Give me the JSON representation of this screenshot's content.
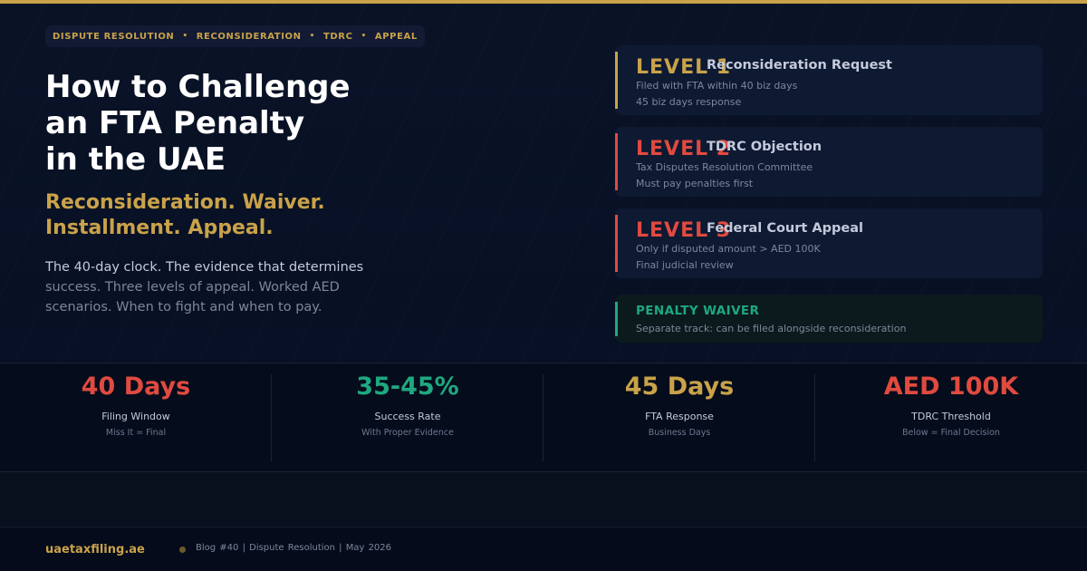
{
  "colors": {
    "gold": "#c9a24a",
    "red": "#e04a3f",
    "green": "#1ea87f"
  },
  "tags": [
    "DISPUTE RESOLUTION",
    "RECONSIDERATION",
    "TDRC",
    "APPEAL"
  ],
  "tag_separator": "•",
  "title": [
    "How to Challenge",
    "an FTA Penalty",
    "in the UAE"
  ],
  "subtitle": [
    "Reconsideration. Waiver.",
    "Installment. Appeal."
  ],
  "description": {
    "lead": "The 40-day clock. The evidence that determines",
    "rest": "success. Three levels of appeal. Worked AED scenarios. When to fight and when to pay."
  },
  "levels": [
    {
      "label": "LEVEL 1",
      "name": "Reconsideration Request",
      "detail": "Filed with FTA within 40 biz days",
      "note": "45 biz days response",
      "color": "#c9a24a"
    },
    {
      "label": "LEVEL 2",
      "name": "TDRC Objection",
      "detail": "Tax Disputes Resolution Committee",
      "note": "Must pay penalties first",
      "color": "#e04a3f"
    },
    {
      "label": "LEVEL 3",
      "name": "Federal Court Appeal",
      "detail": "Only if disputed amount > AED 100K",
      "note": "Final judicial review",
      "color": "#e04a3f"
    }
  ],
  "waiver": {
    "title": "PENALTY WAIVER",
    "detail": "Separate track: can be filed alongside reconsideration"
  },
  "stats": [
    {
      "value": "40 Days",
      "label": "Filing Window",
      "sub": "Miss It = Final",
      "color": "#e04a3f"
    },
    {
      "value": "35-45%",
      "label": "Success Rate",
      "sub": "With Proper Evidence",
      "color": "#1ea87f"
    },
    {
      "value": "45 Days",
      "label": "FTA Response",
      "sub": "Business Days",
      "color": "#c9a24a"
    },
    {
      "value": "AED 100K",
      "label": "TDRC Threshold",
      "sub": "Below = Final Decision",
      "color": "#e04a3f"
    }
  ],
  "footer": {
    "site": "uaetaxfiling.ae",
    "meta": "Blog #40  |  Dispute Resolution  |  May 2026"
  }
}
